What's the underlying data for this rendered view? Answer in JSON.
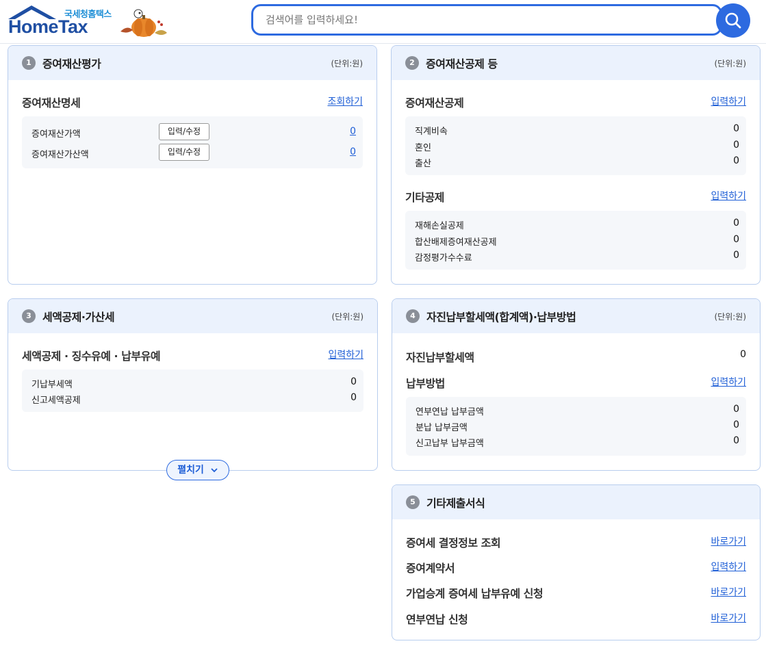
{
  "header": {
    "logo_sub": "국세청홈택스",
    "logo_main": "HomeTax",
    "search_placeholder": "검색어를 입력하세요!"
  },
  "cards": [
    {
      "num": "1",
      "title": "증여재산평가",
      "unit": "(단위:원)",
      "section_title": "증여재산명세",
      "section_link": "조회하기",
      "rows": [
        {
          "label": "증여재산가액",
          "button": "입력/수정",
          "value": "0"
        },
        {
          "label": "증여재산가산액",
          "button": "입력/수정",
          "value": "0"
        }
      ]
    },
    {
      "num": "2",
      "title": "증여재산공제 등",
      "unit": "(단위:원)",
      "sections": [
        {
          "title": "증여재산공제",
          "link": "입력하기",
          "rows": [
            {
              "label": "직계비속",
              "value": "0"
            },
            {
              "label": "혼인",
              "value": "0"
            },
            {
              "label": "출산",
              "value": "0"
            }
          ]
        },
        {
          "title": "기타공제",
          "link": "입력하기",
          "rows": [
            {
              "label": "재해손실공제",
              "value": "0"
            },
            {
              "label": "합산배제증여재산공제",
              "value": "0"
            },
            {
              "label": "감정평가수수료",
              "value": "0"
            }
          ]
        }
      ]
    },
    {
      "num": "3",
      "title": "세액공제·가산세",
      "unit": "(단위:원)",
      "section_title": "세액공제 · 징수유예 · 납부유예",
      "section_link": "입력하기",
      "rows": [
        {
          "label": "기납부세액",
          "value": "0"
        },
        {
          "label": "신고세액공제",
          "value": "0"
        }
      ],
      "expand_label": "펼치기"
    },
    {
      "num": "4",
      "title": "자진납부할세액(합계액)·납부방법",
      "unit": "(단위:원)",
      "total_label": "자진납부할세액",
      "total_value": "0",
      "method_title": "납부방법",
      "method_link": "입력하기",
      "rows": [
        {
          "label": "연부연납 납부금액",
          "value": "0"
        },
        {
          "label": "분납 납부금액",
          "value": "0"
        },
        {
          "label": "신고납부 납부금액",
          "value": "0"
        }
      ]
    },
    {
      "num": "5",
      "title": "기타제출서식",
      "items": [
        {
          "label": "증여세 결정정보 조회",
          "link": "바로가기"
        },
        {
          "label": "증여계약서",
          "link": "입력하기"
        },
        {
          "label": "가업승계 증여세 납부유예 신청",
          "link": "바로가기"
        },
        {
          "label": "연부연납 신청",
          "link": "바로가기"
        }
      ]
    }
  ]
}
